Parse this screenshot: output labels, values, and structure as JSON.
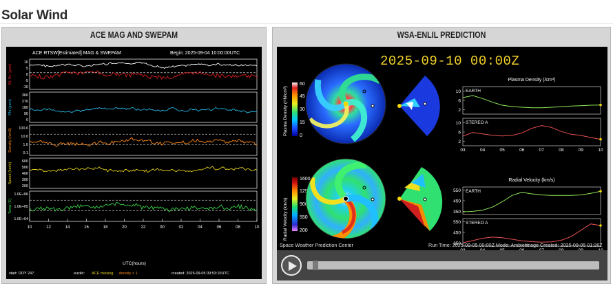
{
  "page": {
    "heading": "Solar Wind"
  },
  "ace_panel": {
    "title": "ACE MAG AND SWEPAM",
    "header_left": "ACE RTSW[Estimated] MAG & SWEPAM",
    "header_right": "Begin: 2025-09-04 10:00:00UTC",
    "footer_left": "start: DOY 247",
    "footer_mid": "euclid:",
    "footer_ace": "ACE missing",
    "footer_density": "density < 1",
    "footer_right": "created: 2025-09-05 09:53:10UTC",
    "x_label": "UTC(hours)",
    "colors": {
      "bt": "#ffffff",
      "bz": "#e02020",
      "phi": "#29b7e6",
      "density": "#ff8a1a",
      "speed": "#e8d21a",
      "temp": "#39d14a"
    }
  },
  "enlil_panel": {
    "title": "WSA-ENLIL PREDICTION",
    "date": "2025-09-10 00:00Z",
    "footer_left": "Space Weather Prediction Center",
    "footer_mid": "Run Time: 2025-09-05 00:00Z  Mode: Ambient",
    "footer_right": "Image Created: 2025-09-05 01:26Z",
    "density_cbar_label": "Plasma Density (r²N/cm³)",
    "velocity_cbar_label": "Radial Velocity (km/s)",
    "player": {
      "play_icon": "play-icon",
      "progress": 0.02
    }
  },
  "chart_data": [
    {
      "type": "line",
      "title": "ACE RTSW[Estimated] MAG & SWEPAM",
      "x_ticks": [
        "10",
        "12",
        "14",
        "16",
        "18",
        "20",
        "22",
        "00",
        "02",
        "04",
        "06",
        "08",
        "10"
      ],
      "xlabel": "UTC(hours)",
      "series": [
        {
          "name": "Bt",
          "ylabel": "Bt, Bz (gsm)",
          "yticks": [
            "10",
            "5",
            "0",
            "-5",
            "-10"
          ],
          "approx_level": 5
        },
        {
          "name": "Bz",
          "approx_level": -1
        },
        {
          "name": "Phi",
          "ylabel": "Phi (gsm)",
          "yticks": [
            "360",
            "270",
            "180",
            "90",
            "0"
          ],
          "approx_level": 135
        },
        {
          "name": "Density",
          "ylabel": "Density (/cm3)",
          "yticks": [
            "100.0",
            "10.0",
            "1.0",
            "0.1"
          ],
          "approx_level": 2
        },
        {
          "name": "Speed",
          "ylabel": "Speed (km/s)",
          "yticks": [
            "600",
            "500",
            "400",
            "300",
            "200"
          ],
          "approx_level": 440
        },
        {
          "name": "Temp",
          "ylabel": "Temp (K)",
          "yticks": [
            "1.0E+06",
            "1.0E+05",
            "1.0E+04"
          ],
          "approx_level": 60000
        }
      ]
    },
    {
      "type": "line",
      "title": "Plasma Density (/cm³)",
      "x_ticks": [
        "03",
        "04",
        "05",
        "06",
        "07",
        "08",
        "09",
        "10"
      ],
      "panels": [
        {
          "name": "EARTH",
          "yticks": [
            "10",
            "6",
            "2"
          ],
          "ylim": [
            0,
            12
          ],
          "x": [
            3,
            3.5,
            4,
            4.5,
            5,
            5.5,
            6,
            6.5,
            7,
            7.5,
            8,
            8.5,
            9,
            9.5,
            10
          ],
          "y": [
            7.2,
            8.1,
            6.8,
            5.2,
            3.9,
            3.3,
            3.0,
            2.8,
            2.8,
            3.0,
            3.2,
            3.5,
            3.7,
            3.9,
            4.0
          ]
        },
        {
          "name": "STEREO A",
          "yticks": [
            "10",
            "6",
            "2"
          ],
          "ylim": [
            0,
            12
          ],
          "x": [
            3,
            3.5,
            4,
            4.5,
            5,
            5.5,
            6,
            6.5,
            7,
            7.5,
            8,
            8.5,
            9,
            9.5,
            10
          ],
          "y": [
            4.2,
            5.8,
            5.2,
            4.6,
            4.3,
            4.5,
            5.6,
            7.6,
            8.8,
            8.0,
            6.2,
            5.0,
            4.5,
            3.6,
            2.8
          ]
        }
      ]
    },
    {
      "type": "line",
      "title": "Radial Velocity (km/s)",
      "x_ticks": [
        "03",
        "04",
        "05",
        "06",
        "07",
        "08",
        "09",
        "10"
      ],
      "panels": [
        {
          "name": "EARTH",
          "yticks": [
            "550",
            "450",
            "350"
          ],
          "ylim": [
            320,
            580
          ],
          "x": [
            3,
            3.5,
            4,
            4.5,
            5,
            5.5,
            6,
            6.5,
            7,
            7.5,
            8,
            8.5,
            9,
            9.5,
            10
          ],
          "y": [
            345,
            350,
            360,
            390,
            440,
            500,
            530,
            515,
            505,
            500,
            500,
            500,
            505,
            520,
            540
          ]
        },
        {
          "name": "STEREO A",
          "yticks": [
            "550",
            "450",
            "350"
          ],
          "ylim": [
            320,
            580
          ],
          "x": [
            3,
            3.5,
            4,
            4.5,
            5,
            5.5,
            6,
            6.5,
            7,
            7.5,
            8,
            8.5,
            9,
            9.5,
            10
          ],
          "y": [
            352,
            372,
            395,
            405,
            400,
            385,
            370,
            362,
            358,
            360,
            375,
            410,
            470,
            530,
            515
          ]
        }
      ]
    }
  ]
}
